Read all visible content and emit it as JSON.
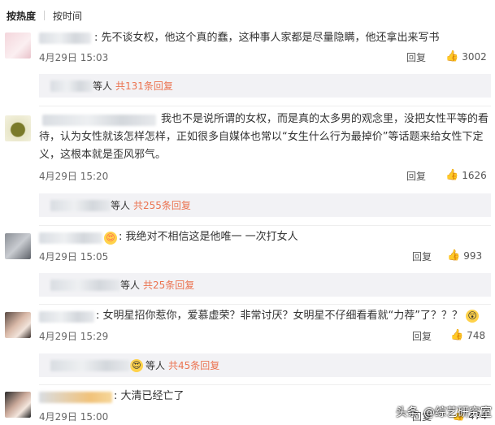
{
  "sort": {
    "hot": "按热度",
    "time": "按时间"
  },
  "comments": [
    {
      "text": "先不谈女权，他这个真的蠢，这种事人家都是尽量隐瞒，他还拿出来写书",
      "time": "4月29日 15:03",
      "reply_label": "回复",
      "likes": "3002",
      "replies_prefix": "等人",
      "replies_count": "共131条回复"
    },
    {
      "text_line1": "我也不是说所谓的女权，而是真的太多男的观念里，没把女性平等的看",
      "text_line2": "待，认为女性就该怎样怎样，正如很多自媒体也常以“女生什么行为最掉价”等话题来给女性下定",
      "text_line3": "义，这根本就是歪风邪气。",
      "time": "4月29日 15:20",
      "reply_label": "回复",
      "likes": "1626",
      "replies_prefix": "等人",
      "replies_count": "共255条回复"
    },
    {
      "text": "我绝对不相信这是他唯一 一次打女人",
      "time": "4月29日 15:05",
      "reply_label": "回复",
      "likes": "993",
      "replies_prefix": "等人",
      "replies_count": "共25条回复"
    },
    {
      "text": "女明星招你惹你，爱慕虚荣？非常讨厌？女明星不仔细看看就“力荐”了？？？",
      "time": "4月29日 15:29",
      "reply_label": "回复",
      "likes": "748",
      "replies_prefix": "等人",
      "replies_count": "共45条回复"
    },
    {
      "text": "大清已经亡了",
      "time": "4月29日 15:00",
      "reply_label": "回复",
      "likes": "474"
    }
  ],
  "watermark": {
    "platform": "头条",
    "account": "@综艺研究室"
  }
}
